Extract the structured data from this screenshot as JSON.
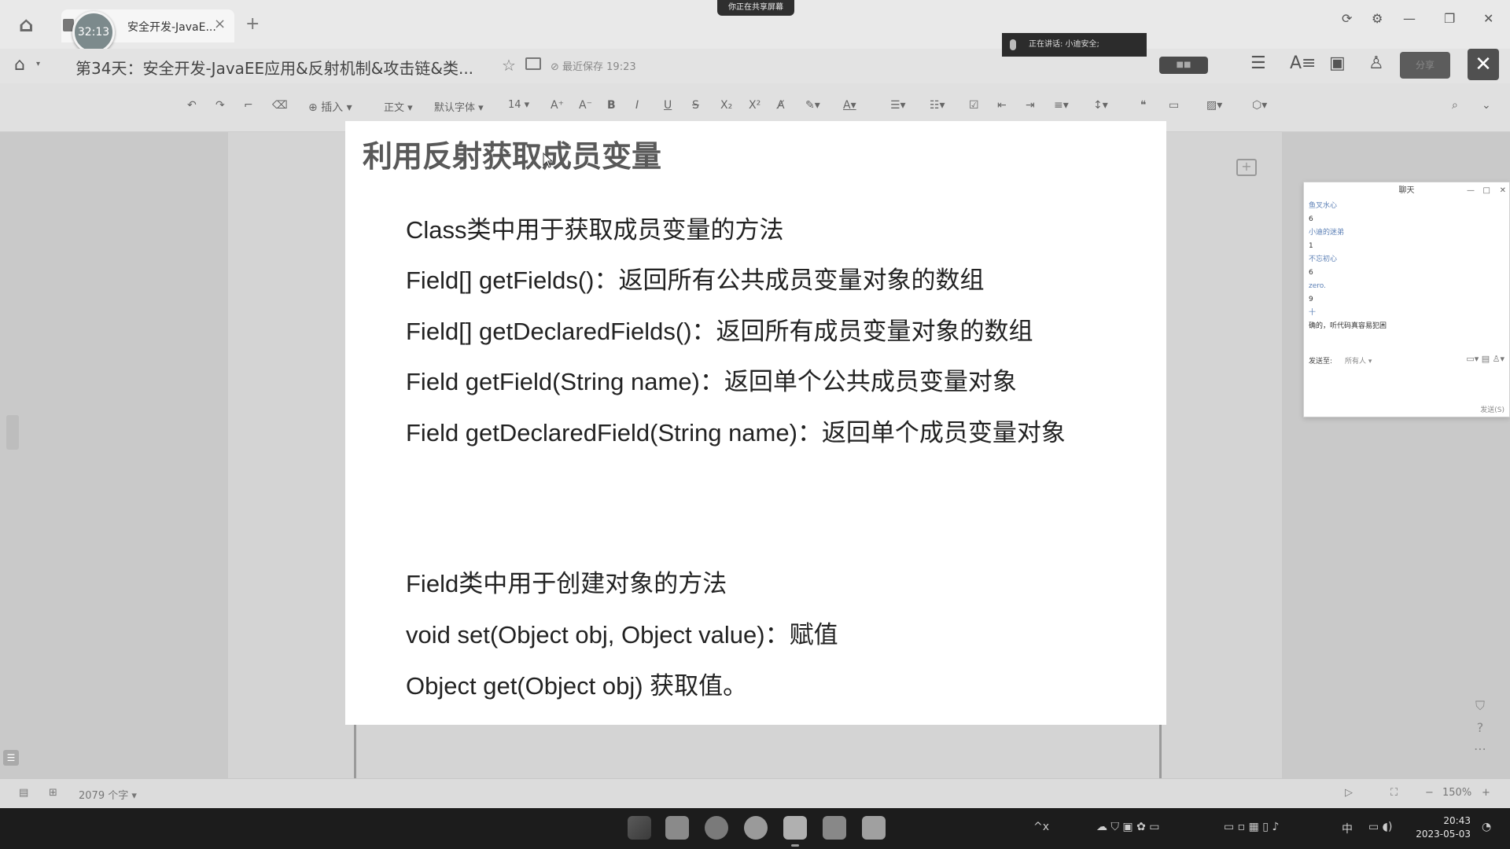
{
  "browser": {
    "timer": "32:13",
    "tab_title": "安全开发-JavaE...",
    "tab_close": "×",
    "new_tab": "+",
    "share_indicator": "你正在共享屏幕",
    "window_controls": [
      "⟳",
      "⚙",
      "—",
      "❐",
      "✕"
    ]
  },
  "doc_header": {
    "title": "第34天：安全开发-JavaEE应用&反射机制&攻击链&类...",
    "save_status": "最近保存 19:23",
    "speaking": "正在讲话: 小迪安全;",
    "share_button": "分享",
    "close": "✕"
  },
  "toolbar": {
    "insert": "插入",
    "style": "正文",
    "font": "默认字体",
    "size": "14"
  },
  "slide": {
    "title": "利用反射获取成员变量",
    "lines": [
      "Class类中用于获取成员变量的方法",
      "Field[] getFields()：返回所有公共成员变量对象的数组",
      "Field[] getDeclaredFields()：返回所有成员变量对象的数组",
      "Field getField(String name)：返回单个公共成员变量对象",
      "Field getDeclaredField(String name)：返回单个成员变量对象",
      "Field类中用于创建对象的方法",
      "void set(Object obj, Object value)：赋值",
      "Object get(Object obj) 获取值。"
    ]
  },
  "chat": {
    "title": "聊天",
    "messages": [
      {
        "name": "鱼叉水心",
        "text": "6"
      },
      {
        "name": "小迪的迷弟",
        "text": "1"
      },
      {
        "name": "不忘初心",
        "text": "6"
      },
      {
        "name": "zero.",
        "text": "9"
      },
      {
        "name": "十",
        "text": "确的，听代码真容易犯困"
      }
    ],
    "send_to_label": "发送至:",
    "send_to_value": "所有人",
    "send_button": "发送(S)"
  },
  "status_bar": {
    "word_count": "2079 个字",
    "zoom": "150%"
  },
  "taskbar": {
    "time": "20:43",
    "date": "2023-05-03",
    "ime": "中"
  }
}
